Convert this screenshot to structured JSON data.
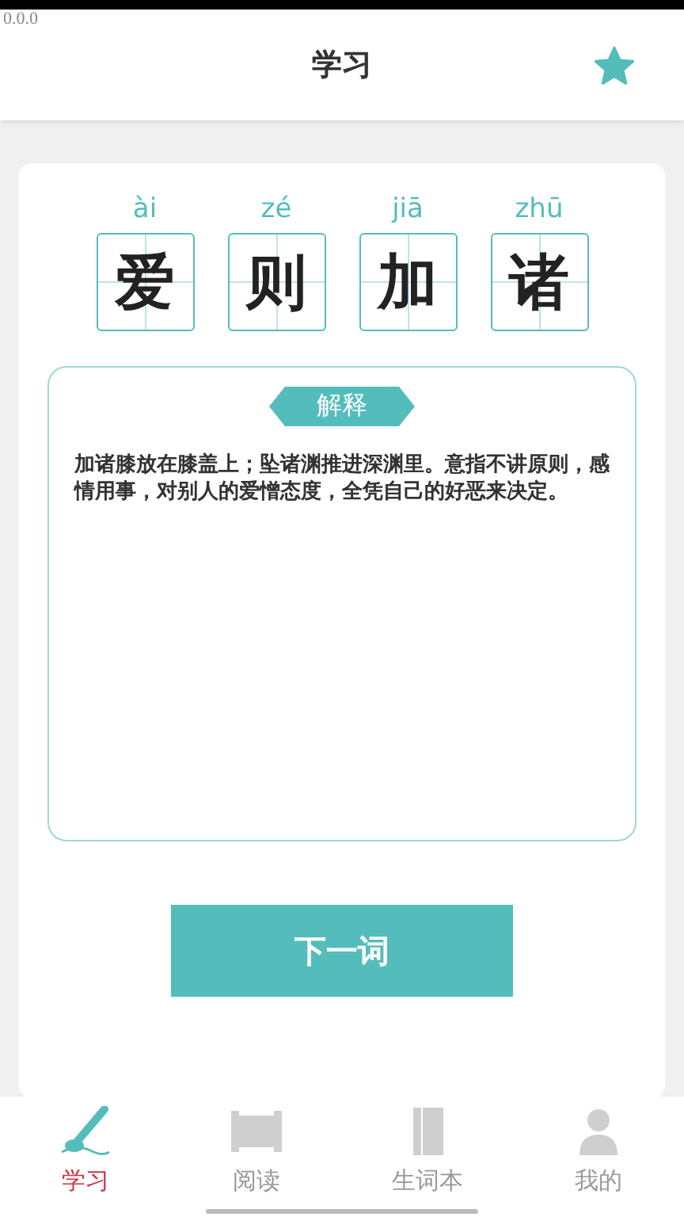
{
  "version": "0.0.0",
  "header": {
    "title": "学习",
    "favorited": true
  },
  "word": [
    {
      "pinyin": "ài",
      "char": "爱"
    },
    {
      "pinyin": "zé",
      "char": "则"
    },
    {
      "pinyin": "jiā",
      "char": "加"
    },
    {
      "pinyin": "zhū",
      "char": "诸"
    }
  ],
  "explanation": {
    "label": "解释",
    "text": "加诸膝放在膝盖上；坠诸渊推进深渊里。意指不讲原则，感情用事，对别人的爱憎态度，全凭自己的好恶来决定。"
  },
  "next_button": "下一词",
  "tabs": [
    {
      "label": "学习",
      "kind": "brush",
      "selected": true
    },
    {
      "label": "阅读",
      "kind": "scroll",
      "selected": false
    },
    {
      "label": "生词本",
      "kind": "book",
      "selected": false
    },
    {
      "label": "我的",
      "kind": "person",
      "selected": false
    }
  ]
}
